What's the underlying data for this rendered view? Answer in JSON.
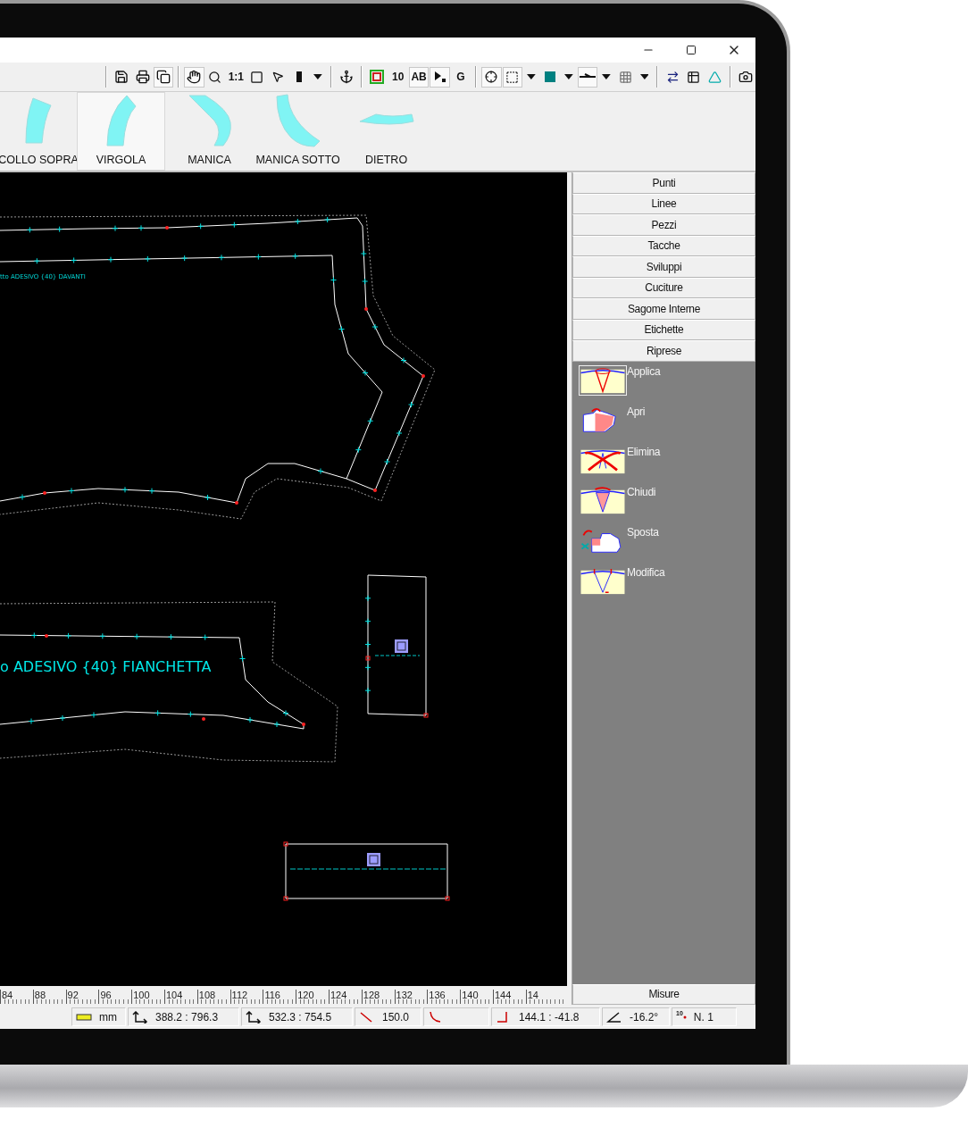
{
  "toolbar": {
    "zoom_label": "1:1",
    "number_label": "10",
    "text_label": "AB",
    "grid_label": "G"
  },
  "pieces": [
    {
      "label": "COLLO SOPRA",
      "kind": "collar",
      "selected": false
    },
    {
      "label": "VIRGOLA",
      "kind": "curve",
      "selected": true
    },
    {
      "label": "MANICA",
      "kind": "sleeve",
      "selected": false
    },
    {
      "label": "MANICA SOTTO",
      "kind": "undersleeve",
      "selected": false
    },
    {
      "label": "DIETRO",
      "kind": "back",
      "selected": false
    }
  ],
  "canvas": {
    "labels": [
      {
        "text": "tto ADESIVO {40} DAVANTI",
        "kind": "small"
      },
      {
        "text": "o ADESIVO {40} FIANCHETTA",
        "kind": "large"
      }
    ]
  },
  "menu": [
    "Punti",
    "Linee",
    "Pezzi",
    "Tacche",
    "Sviluppi",
    "Cuciture",
    "Sagome Interne",
    "Etichette",
    "Riprese"
  ],
  "tools": [
    {
      "label": "Applica",
      "kind": "apply",
      "selected": true
    },
    {
      "label": "Apri",
      "kind": "open",
      "selected": false
    },
    {
      "label": "Elimina",
      "kind": "delete",
      "selected": false
    },
    {
      "label": "Chiudi",
      "kind": "close",
      "selected": false
    },
    {
      "label": "Sposta",
      "kind": "move",
      "selected": false
    },
    {
      "label": "Modifica",
      "kind": "modify",
      "selected": false
    }
  ],
  "measure_button": "Misure",
  "ruler": [
    "84",
    "88",
    "92",
    "96",
    "100",
    "104",
    "108",
    "112",
    "116",
    "120",
    "124",
    "128",
    "132",
    "136",
    "140",
    "144",
    "14"
  ],
  "status": [
    {
      "kind": "unit",
      "text": "mm"
    },
    {
      "kind": "point",
      "text": "388.2 : 796.3"
    },
    {
      "kind": "point",
      "text": "532.3 : 754.5"
    },
    {
      "kind": "length",
      "text": "150.0"
    },
    {
      "kind": "curve"
    },
    {
      "kind": "offset",
      "text": "144.1 : -41.8"
    },
    {
      "kind": "angle",
      "text": "-16.2°"
    },
    {
      "kind": "number",
      "badge": "10",
      "text": "N. 1"
    }
  ]
}
